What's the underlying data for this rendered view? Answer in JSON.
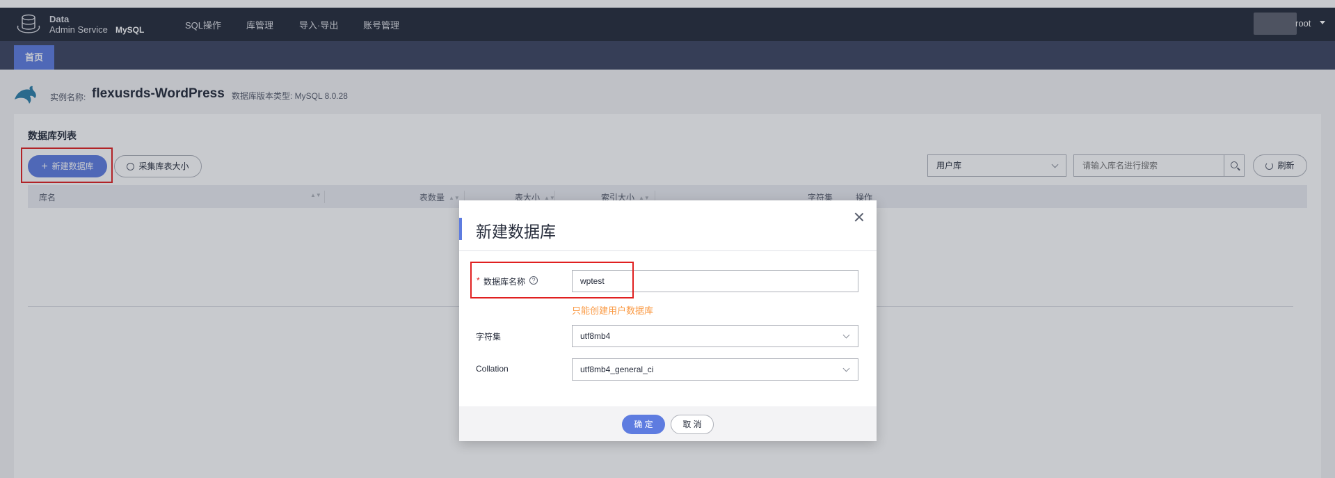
{
  "header": {
    "logo_line1": "Data",
    "logo_line2": "Admin Service",
    "db_type": "MySQL",
    "menu": [
      "SQL操作",
      "库管理",
      "导入·导出",
      "账号管理"
    ],
    "user": "root"
  },
  "tabs": {
    "home": "首页"
  },
  "instance": {
    "name_label": "实例名称:",
    "name": "flexusrds-WordPress",
    "version_label": "数据库版本类型: MySQL 8.0.28"
  },
  "panel": {
    "title": "数据库列表",
    "new_db_button": "新建数据库",
    "collect_button": "采集库表大小",
    "db_type_select": "用户库",
    "search_placeholder": "请输入库名进行搜索",
    "refresh_button": "刷新"
  },
  "table": {
    "columns": [
      "库名",
      "表数量",
      "表大小",
      "索引大小",
      "字符集",
      "操作"
    ]
  },
  "dialog": {
    "title": "新建数据库",
    "name_label": "数据库名称",
    "name_value": "wptest",
    "name_hint": "只能创建用户数据库",
    "charset_label": "字符集",
    "charset_value": "utf8mb4",
    "collation_label": "Collation",
    "collation_value": "utf8mb4_general_ci",
    "ok_button": "确 定",
    "cancel_button": "取 消"
  },
  "colors": {
    "navbar": "#252b3a",
    "tabbar": "#3d4460",
    "primary": "#5e7ce0",
    "highlight_box": "#e02020",
    "hint": "#fa9841"
  }
}
